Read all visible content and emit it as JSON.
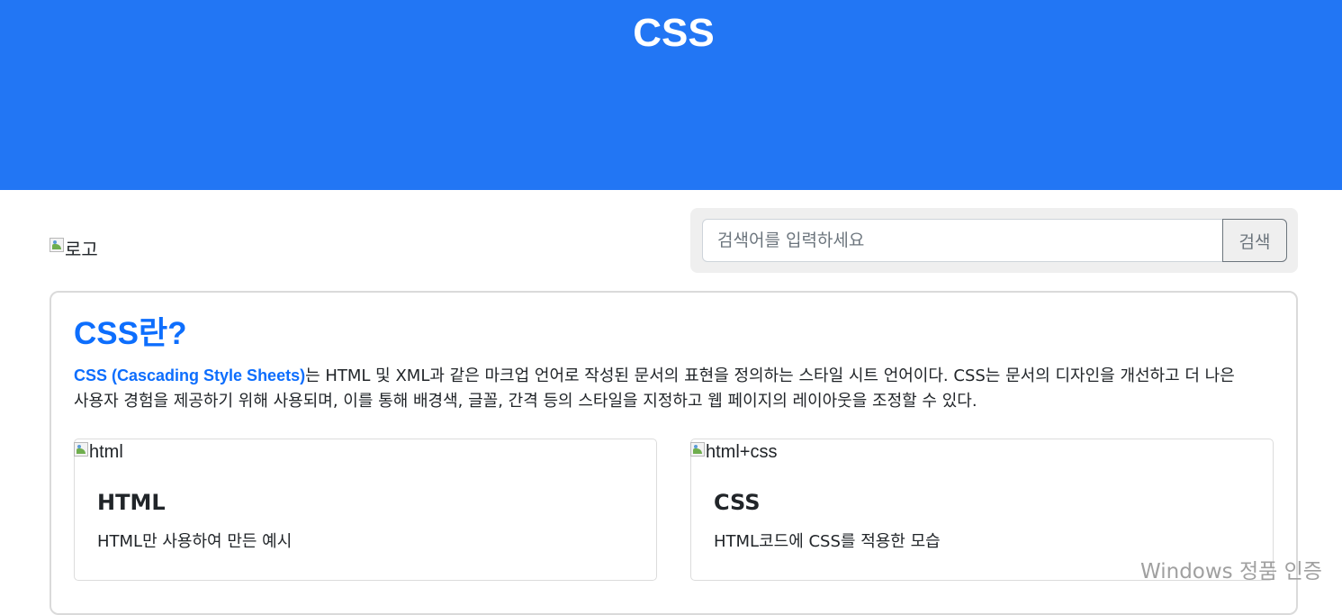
{
  "header": {
    "title": "CSS"
  },
  "logo": {
    "alt_text": "로고"
  },
  "search": {
    "placeholder": "검색어를 입력하세요",
    "value": "",
    "button_label": "검색"
  },
  "intro": {
    "heading": "CSS란?",
    "term": "CSS (Cascading Style Sheets)",
    "description": "는 HTML 및 XML과 같은 마크업 언어로 작성된 문서의 표현을 정의하는 스타일 시트 언어이다. CSS는 문서의 디자인을 개선하고 더 나은 사용자 경험을 제공하기 위해 사용되며, 이를 통해 배경색, 글꼴, 간격 등의 스타일을 지정하고 웹 페이지의 레이아웃을 조정할 수 있다."
  },
  "cards": [
    {
      "image_alt": "html",
      "title": "HTML",
      "text": "HTML만 사용하여 만든 예시"
    },
    {
      "image_alt": "html+css",
      "title": "CSS",
      "text": "HTML코드에 CSS를 적용한 모습"
    }
  ],
  "overlay": {
    "watermark": "Windows 정품 인증"
  },
  "colors": {
    "header_bg": "#2276f4",
    "accent": "#0d6efd",
    "search_panel_bg": "#efefef"
  }
}
